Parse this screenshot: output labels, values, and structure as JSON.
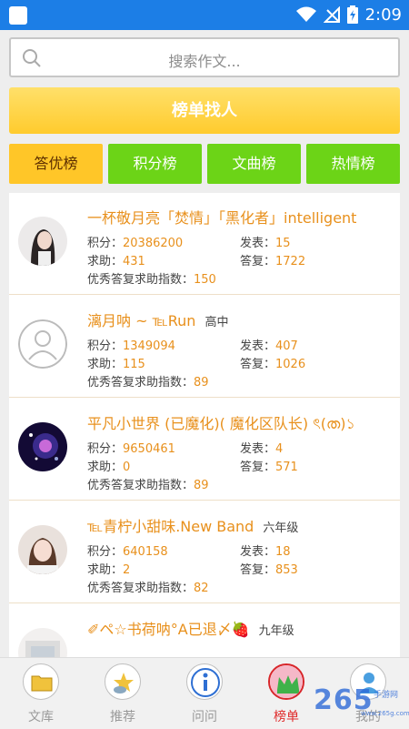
{
  "statusbar": {
    "time": "2:09"
  },
  "search": {
    "placeholder": "搜索作文..."
  },
  "find_button": {
    "label": "榜单找人"
  },
  "tabs": [
    {
      "label": "答优榜",
      "active": true
    },
    {
      "label": "积分榜"
    },
    {
      "label": "文曲榜"
    },
    {
      "label": "热情榜"
    }
  ],
  "stat_labels": {
    "points": "积分：",
    "posts": "发表：",
    "help": "求助：",
    "replies": "答复：",
    "index": "优秀答复求助指数："
  },
  "users": [
    {
      "name": "一杯敬月亮「焚情」「黑化者」intelligent",
      "grade": "",
      "points": "20386200",
      "posts": "15",
      "help": "431",
      "replies": "1722",
      "index": "150"
    },
    {
      "name": "漓月呐 ~ ℡Run",
      "grade": "高中",
      "points": "1349094",
      "posts": "407",
      "help": "115",
      "replies": "1026",
      "index": "89"
    },
    {
      "name": "平凡小世界 (已魔化)( 魔化区队长) ৎ(ത)১",
      "grade": "",
      "points": "9650461",
      "posts": "4",
      "help": "0",
      "replies": "571",
      "index": "89"
    },
    {
      "name": "℡青柠小甜味.New Band",
      "grade": "六年级",
      "points": "640158",
      "posts": "18",
      "help": "2",
      "replies": "853",
      "index": "82"
    },
    {
      "name": "✐ペ☆书荷呐°A已退〆🍓",
      "grade": "九年级",
      "points": "",
      "posts": "",
      "help": "",
      "replies": "",
      "index": ""
    }
  ],
  "nav": [
    {
      "label": "文库",
      "icon": "folder-icon"
    },
    {
      "label": "推荐",
      "icon": "recommend-icon"
    },
    {
      "label": "问问",
      "icon": "info-icon"
    },
    {
      "label": "榜单",
      "icon": "crown-icon",
      "active": true
    },
    {
      "label": "我的",
      "icon": "user-icon"
    }
  ],
  "watermark": {
    "brand": "265",
    "sub": "手游网",
    "url": "www.265g.com"
  },
  "colors": {
    "accent_orange": "#e8901c",
    "tab_green": "#6cd417",
    "tab_yellow": "#ffc628",
    "statusbar_blue": "#1c7ee6",
    "active_nav_red": "#e02a2a"
  }
}
